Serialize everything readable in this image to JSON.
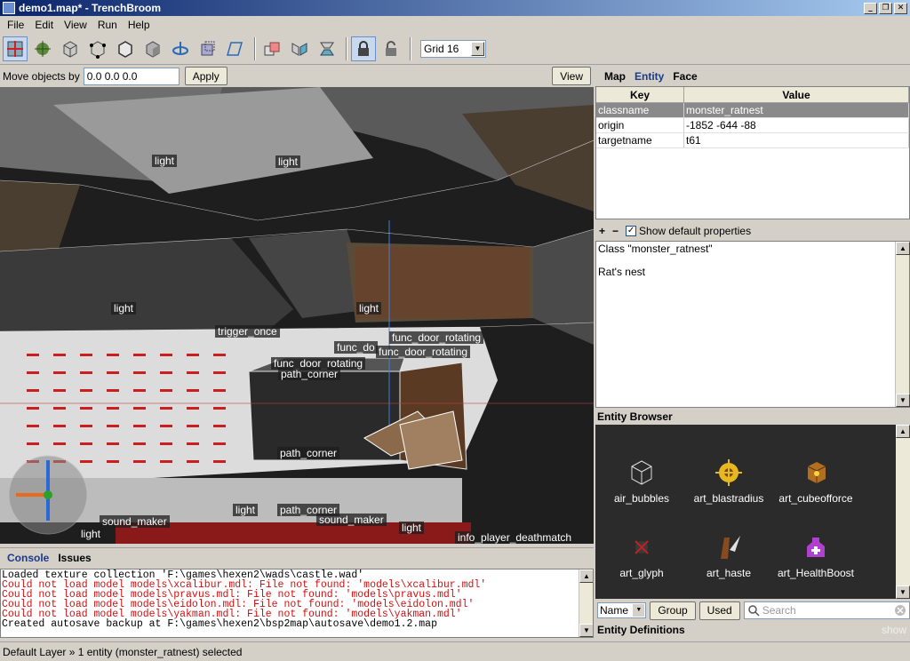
{
  "window": {
    "title": "demo1.map* - TrenchBroom",
    "controls": [
      "_",
      "❐",
      "✕"
    ]
  },
  "menu": [
    "File",
    "Edit",
    "View",
    "Run",
    "Help"
  ],
  "toolbar": {
    "grid_label": "Grid 16"
  },
  "move": {
    "label": "Move objects by",
    "value": "0.0 0.0 0.0",
    "apply": "Apply",
    "view": "View"
  },
  "viewport_labels": {
    "light1": "light",
    "light2": "light",
    "light3": "light",
    "light4": "light",
    "trigger": "trigger_once",
    "door1": "func_door_rotating",
    "door2": "func_door_rotating",
    "door3": "func_door_rotating",
    "func_partial": "func_do",
    "path1": "path_corner",
    "path2": "path_corner",
    "path3": "path_corner",
    "sound1": "sound_maker",
    "sound2": "sound_maker",
    "light5": "light",
    "light6": "light",
    "light7": "light",
    "player": "info_player_deathmatch"
  },
  "console": {
    "tabs": [
      "Console",
      "Issues"
    ],
    "lines": [
      {
        "text": "Loaded texture collection 'F:\\games\\hexen2\\wads\\castle.wad'",
        "type": "info"
      },
      {
        "text": "Could not load model models\\xcalibur.mdl: File not found: 'models\\xcalibur.mdl'",
        "type": "err"
      },
      {
        "text": "Could not load model models\\pravus.mdl: File not found: 'models\\pravus.mdl'",
        "type": "err"
      },
      {
        "text": "Could not load model models\\eidolon.mdl: File not found: 'models\\eidolon.mdl'",
        "type": "err"
      },
      {
        "text": "Could not load model models\\yakman.mdl: File not found: 'models\\yakman.mdl'",
        "type": "err"
      },
      {
        "text": "Created autosave backup at F:\\games\\hexen2\\bsp2map\\autosave\\demo1.2.map",
        "type": "info"
      }
    ]
  },
  "status": "Default Layer » 1 entity (monster_ratnest) selected",
  "inspector": {
    "tabs": [
      "Map",
      "Entity",
      "Face"
    ],
    "columns": {
      "key": "Key",
      "value": "Value"
    },
    "properties": [
      {
        "key": "classname",
        "value": "monster_ratnest"
      },
      {
        "key": "origin",
        "value": "-1852 -644 -88"
      },
      {
        "key": "targetname",
        "value": "t61"
      }
    ],
    "add": "+",
    "remove": "−",
    "show_default": "Show default properties",
    "class_line": "Class \"monster_ratnest\"",
    "class_desc": "Rat's nest"
  },
  "entity_browser": {
    "title": "Entity Browser",
    "items": [
      "air_bubbles",
      "art_blastradius",
      "art_cubeofforce",
      "art_glyph",
      "art_haste",
      "art_HealthBoost"
    ],
    "sort": "Name",
    "group": "Group",
    "used": "Used",
    "search_placeholder": "Search"
  },
  "entity_definitions": {
    "title": "Entity Definitions",
    "show": "show"
  }
}
